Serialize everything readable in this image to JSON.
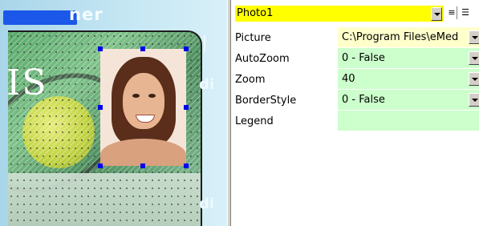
{
  "designer": {
    "header_partial": "ner",
    "card_big_text": "IS",
    "side_text_top": "di",
    "side_text_bottom": "di"
  },
  "property_grid": {
    "object_name": "Photo1",
    "colors": {
      "object_selector": "#ffff00",
      "value_cell": "#ccffcc",
      "value_cell_active": "#ffffcc",
      "selection_handle": "#0000f0"
    },
    "toolbar": {
      "sort_categorized_icon": "categorized-icon",
      "sort_alphabetical_icon": "alphabetical-icon"
    },
    "properties": [
      {
        "name": "Picture",
        "value": "C:\\Program Files\\eMed",
        "has_dropdown": true
      },
      {
        "name": "AutoZoom",
        "value": "0 - False",
        "has_dropdown": true
      },
      {
        "name": "Zoom",
        "value": "40",
        "has_dropdown": true
      },
      {
        "name": "BorderStyle",
        "value": "0 - False",
        "has_dropdown": true
      },
      {
        "name": "Legend",
        "value": "",
        "has_dropdown": false
      }
    ]
  }
}
